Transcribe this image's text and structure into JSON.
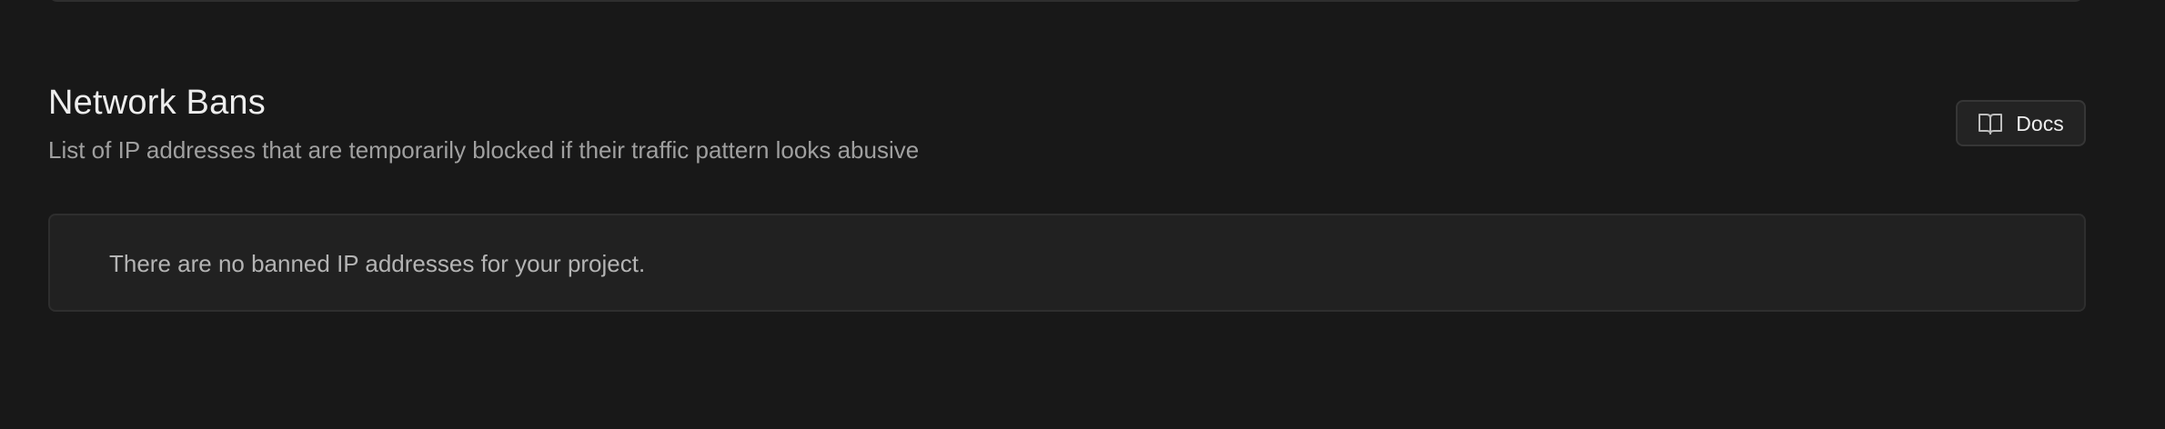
{
  "section": {
    "title": "Network Bans",
    "description": "List of IP addresses that are temporarily blocked if their traffic pattern looks abusive"
  },
  "docs_button": {
    "label": "Docs",
    "icon": "book-open-icon"
  },
  "empty_state": {
    "message": "There are no banned IP addresses for your project."
  },
  "colors": {
    "background": "#181818",
    "panel": "#212121",
    "border": "#2e2e2e",
    "text_primary": "#ededed",
    "text_secondary": "#a0a0a0"
  }
}
